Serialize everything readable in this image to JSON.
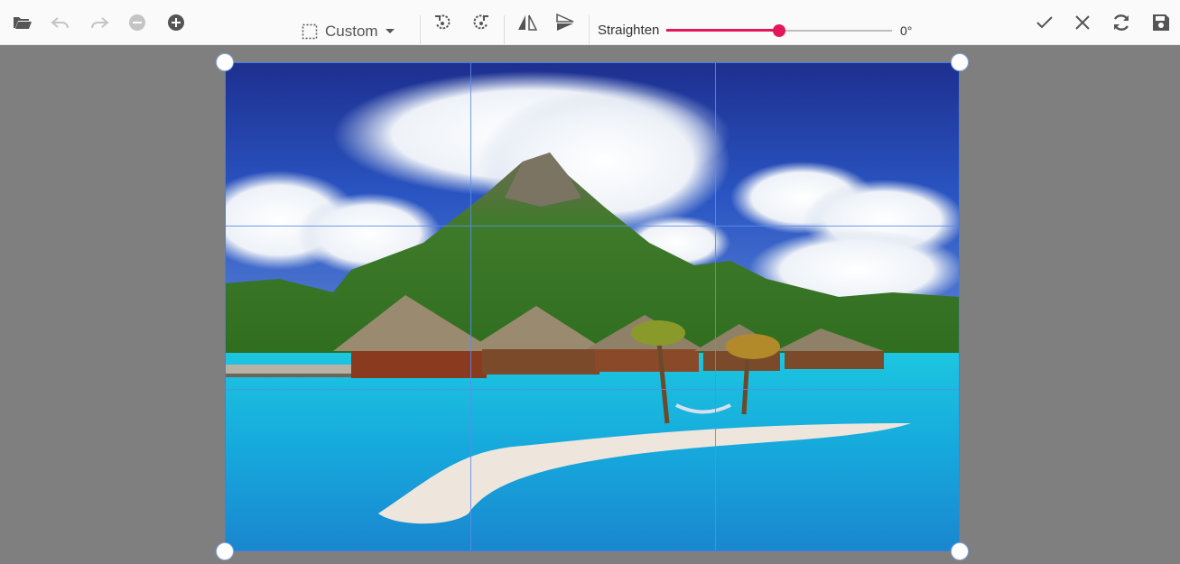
{
  "toolbar": {
    "left_buttons": [
      {
        "name": "open-button",
        "icon": "folder-open-icon",
        "enabled": true
      },
      {
        "name": "undo-button",
        "icon": "undo-icon",
        "enabled": false
      },
      {
        "name": "redo-button",
        "icon": "redo-icon",
        "enabled": false
      },
      {
        "name": "zoom-out-button",
        "icon": "zoom-out-icon",
        "enabled": false
      },
      {
        "name": "zoom-in-button",
        "icon": "zoom-in-icon",
        "enabled": true
      }
    ],
    "aspect_ratio": {
      "label": "Custom",
      "icon": "dotted-square-icon"
    },
    "transform_buttons": [
      {
        "name": "rotate-left-button",
        "icon": "rotate-left-icon"
      },
      {
        "name": "rotate-right-button",
        "icon": "rotate-right-icon"
      },
      {
        "name": "flip-horizontal-button",
        "icon": "flip-horizontal-icon"
      },
      {
        "name": "flip-vertical-button",
        "icon": "flip-vertical-icon"
      }
    ],
    "straighten": {
      "label": "Straighten",
      "value_text": "0°",
      "fraction": 0.5
    },
    "right_buttons": [
      {
        "name": "apply-button",
        "icon": "check-icon"
      },
      {
        "name": "cancel-button",
        "icon": "close-icon"
      },
      {
        "name": "reset-button",
        "icon": "refresh-icon"
      },
      {
        "name": "save-button",
        "icon": "save-icon"
      }
    ]
  },
  "colors": {
    "accent": "#e3165b",
    "crop_border": "#3f7fe8",
    "workspace_bg": "#7f7f7f",
    "icon": "#555555",
    "icon_disabled": "#c4c4c4"
  },
  "image": {
    "subject": "tropical island bungalows over turquoise lagoon beneath a mountain"
  }
}
